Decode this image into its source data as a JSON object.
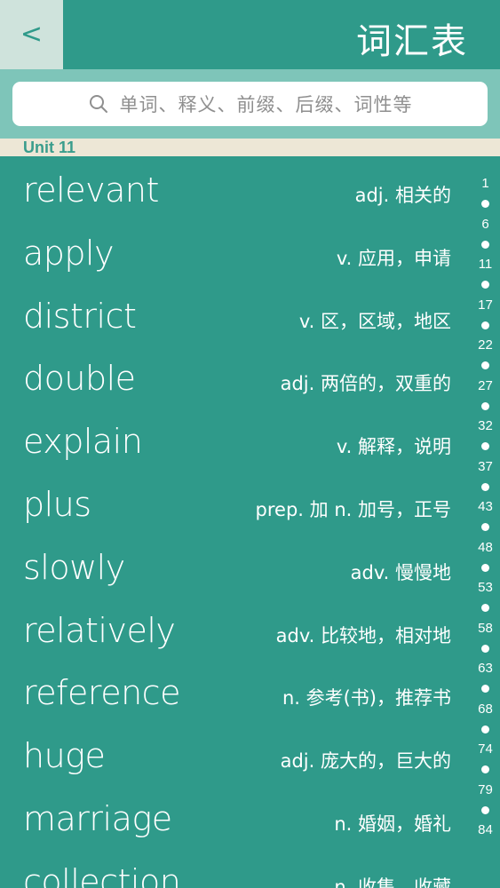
{
  "header": {
    "back_label": "<",
    "title": "词汇表"
  },
  "search": {
    "placeholder": "单词、释义、前缀、后缀、词性等"
  },
  "section": {
    "label": "Unit 11"
  },
  "words": [
    {
      "word": "relevant",
      "meaning": "adj. 相关的"
    },
    {
      "word": "apply",
      "meaning": "v. 应用，申请"
    },
    {
      "word": "district",
      "meaning": "v. 区，区域，地区"
    },
    {
      "word": "double",
      "meaning": "adj. 两倍的，双重的"
    },
    {
      "word": "explain",
      "meaning": "v. 解释，说明"
    },
    {
      "word": "plus",
      "meaning": "prep. 加  n. 加号，正号"
    },
    {
      "word": "slowly",
      "meaning": "adv. 慢慢地"
    },
    {
      "word": "relatively",
      "meaning": "adv. 比较地，相对地"
    },
    {
      "word": "reference",
      "meaning": "n. 参考(书)，推荐书"
    },
    {
      "word": "huge",
      "meaning": "adj. 庞大的，巨大的"
    },
    {
      "word": "marriage",
      "meaning": "n. 婚姻，婚礼"
    },
    {
      "word": "collection",
      "meaning": "n. 收集，收藏"
    }
  ],
  "index": [
    "1",
    "6",
    "11",
    "17",
    "22",
    "27",
    "32",
    "37",
    "43",
    "48",
    "53",
    "58",
    "63",
    "68",
    "74",
    "79",
    "84"
  ],
  "colors": {
    "primary": "#2f9a8a",
    "search_band": "#7ec5b9",
    "back_button": "#cfe3dc",
    "unit_header": "#ede7d6"
  }
}
